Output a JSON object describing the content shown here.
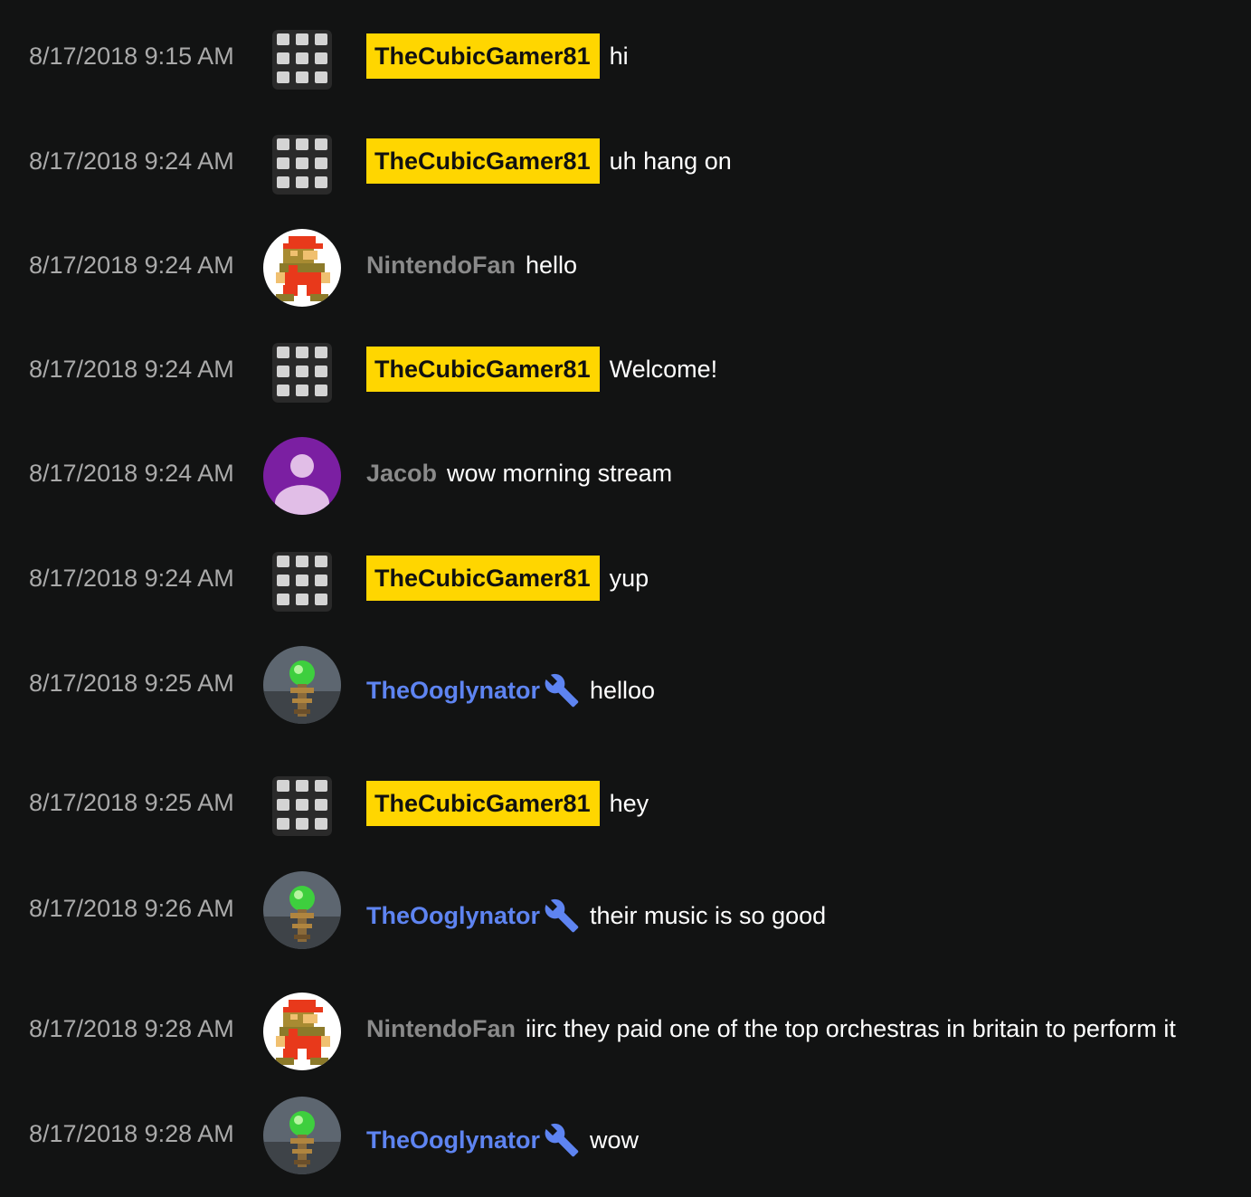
{
  "colors": {
    "background": "#121313",
    "timestamp": "#aaaaaa",
    "owner_badge": "#ffd600",
    "plain_author": "#8a8a8a",
    "moderator_author": "#5e84f1",
    "message_text": "#ffffff"
  },
  "messages": [
    {
      "timestamp": "8/17/2018 9:15 AM",
      "author": "TheCubicGamer81",
      "role": "owner",
      "avatar": "grid-logo-icon",
      "text": "hi"
    },
    {
      "timestamp": "8/17/2018 9:24 AM",
      "author": "TheCubicGamer81",
      "role": "owner",
      "avatar": "grid-logo-icon",
      "text": "uh hang on"
    },
    {
      "timestamp": "8/17/2018 9:24 AM",
      "author": "NintendoFan",
      "role": "member",
      "avatar": "mario-avatar",
      "text": "hello"
    },
    {
      "timestamp": "8/17/2018 9:24 AM",
      "author": "TheCubicGamer81",
      "role": "owner",
      "avatar": "grid-logo-icon",
      "text": "Welcome!"
    },
    {
      "timestamp": "8/17/2018 9:24 AM",
      "author": "Jacob",
      "role": "member",
      "avatar": "default-person-avatar",
      "text": "wow morning stream"
    },
    {
      "timestamp": "8/17/2018 9:24 AM",
      "author": "TheCubicGamer81",
      "role": "owner",
      "avatar": "grid-logo-icon",
      "text": "yup"
    },
    {
      "timestamp": "8/17/2018 9:25 AM",
      "author": "TheOoglynator",
      "role": "moderator",
      "avatar": "staff-avatar",
      "text": "helloo"
    },
    {
      "timestamp": "8/17/2018 9:25 AM",
      "author": "TheCubicGamer81",
      "role": "owner",
      "avatar": "grid-logo-icon",
      "text": "hey"
    },
    {
      "timestamp": "8/17/2018 9:26 AM",
      "author": "TheOoglynator",
      "role": "moderator",
      "avatar": "staff-avatar",
      "text": "their music is so good"
    },
    {
      "timestamp": "8/17/2018 9:28 AM",
      "author": "NintendoFan",
      "role": "member",
      "avatar": "mario-avatar",
      "text": "iirc they paid one of the top orchestras in britain to perform it"
    },
    {
      "timestamp": "8/17/2018 9:28 AM",
      "author": "TheOoglynator",
      "role": "moderator",
      "avatar": "staff-avatar",
      "text": "wow"
    }
  ]
}
